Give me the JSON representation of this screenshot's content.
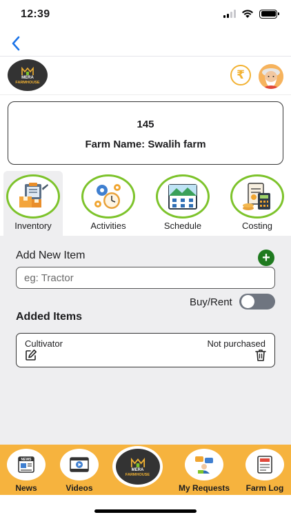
{
  "status_bar": {
    "time": "12:39"
  },
  "brand": {
    "line1": "MERA",
    "line2": "FARMHOUSE",
    "accent": "#f2b233"
  },
  "header": {
    "currency_symbol": "₹"
  },
  "farm": {
    "id": "145",
    "name_line": "Farm Name: Swalih farm"
  },
  "categories": [
    {
      "label": "Inventory",
      "icon": "inventory-icon",
      "active": true
    },
    {
      "label": "Activities",
      "icon": "activities-icon",
      "active": false
    },
    {
      "label": "Schedule",
      "icon": "schedule-icon",
      "active": false
    },
    {
      "label": "Costing",
      "icon": "costing-icon",
      "active": false
    }
  ],
  "inventory": {
    "add_title": "Add New Item",
    "add_button": "+",
    "input_placeholder": "eg: Tractor",
    "input_value": "",
    "toggle_label": "Buy/Rent",
    "toggle_on": false,
    "added_title": "Added Items",
    "items": [
      {
        "name": "Cultivator",
        "status": "Not purchased"
      }
    ]
  },
  "tabbar": {
    "tabs": [
      {
        "label": "News",
        "icon": "news-icon"
      },
      {
        "label": "Videos",
        "icon": "videos-icon"
      },
      {
        "label": "My Requests",
        "icon": "requests-icon"
      },
      {
        "label": "Farm Log",
        "icon": "farm-log-icon"
      }
    ],
    "background": "#f6b33e"
  },
  "colors": {
    "category_ring": "#7dc32b",
    "add_button": "#1f7a1f",
    "back_arrow": "#1a73e8"
  }
}
